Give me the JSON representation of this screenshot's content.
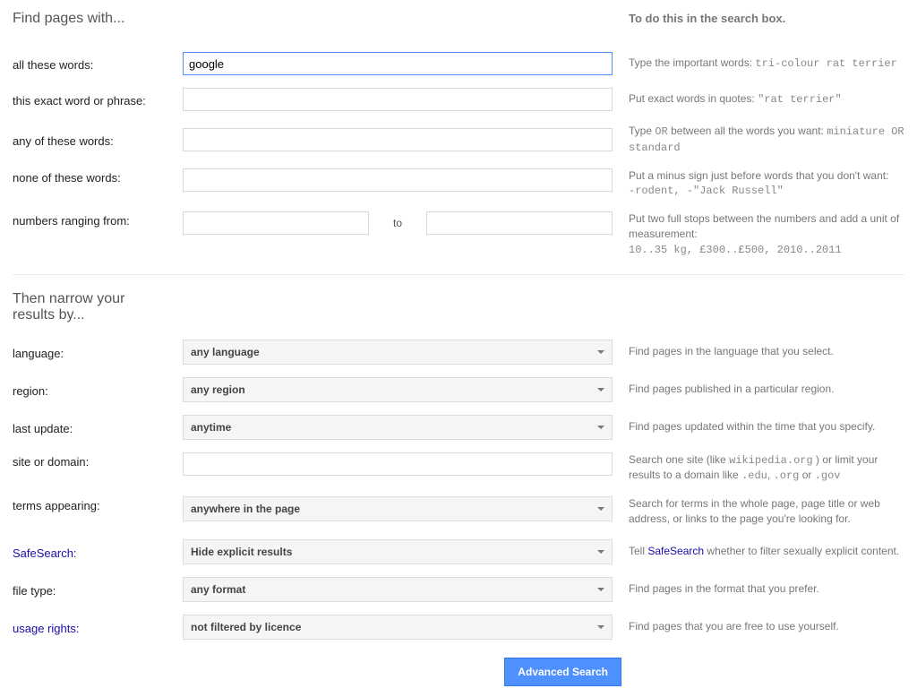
{
  "headers": {
    "find_pages": "Find pages with...",
    "search_box_hint": "To do this in the search box.",
    "narrow": "Then narrow your results by..."
  },
  "fields": {
    "all_words": {
      "label": "all these words:",
      "value": "google",
      "hint_prefix": "Type the important words: ",
      "hint_code": "tri-colour rat terrier"
    },
    "exact": {
      "label": "this exact word or phrase:",
      "value": "",
      "hint_prefix": "Put exact words in quotes: ",
      "hint_code": "\"rat terrier\""
    },
    "any": {
      "label": "any of these words:",
      "value": "",
      "hint_a": "Type ",
      "hint_or": "OR",
      "hint_b": " between all the words you want: ",
      "hint_code": "miniature OR standard"
    },
    "none": {
      "label": "none of these words:",
      "value": "",
      "hint_a": "Put a minus sign just before words that you don't want:",
      "hint_code": "-rodent, -\"Jack Russell\""
    },
    "range": {
      "label": "numbers ranging from:",
      "from": "",
      "to_label": "to",
      "to": "",
      "hint_a": "Put two full stops between the numbers and add a unit of measurement:",
      "hint_code": "10..35 kg, £300..£500, 2010..2011"
    }
  },
  "narrow": {
    "language": {
      "label": "language:",
      "value": "any language",
      "hint": "Find pages in the language that you select."
    },
    "region": {
      "label": "region:",
      "value": "any region",
      "hint": "Find pages published in a particular region."
    },
    "last_update": {
      "label": "last update:",
      "value": "anytime",
      "hint": "Find pages updated within the time that you specify."
    },
    "site": {
      "label": "site or domain:",
      "value": "",
      "hint_a": "Search one site (like ",
      "hint_code1": "wikipedia.org",
      "hint_b": " ) or limit your results to a domain like ",
      "hint_code2": ".edu",
      "hint_c": ", ",
      "hint_code3": ".org",
      "hint_d": " or ",
      "hint_code4": ".gov"
    },
    "terms": {
      "label": "terms appearing:",
      "value": "anywhere in the page",
      "hint": "Search for terms in the whole page, page title or web address, or links to the page you're looking for."
    },
    "safesearch": {
      "label": "SafeSearch:",
      "value": "Hide explicit results",
      "hint_a": "Tell ",
      "hint_link": "SafeSearch",
      "hint_b": " whether to filter sexually explicit content."
    },
    "filetype": {
      "label": "file type:",
      "value": "any format",
      "hint": "Find pages in the format that you prefer."
    },
    "usage": {
      "label": "usage rights:",
      "value": "not filtered by licence",
      "hint": "Find pages that you are free to use yourself."
    }
  },
  "button": {
    "advanced_search": "Advanced Search"
  }
}
